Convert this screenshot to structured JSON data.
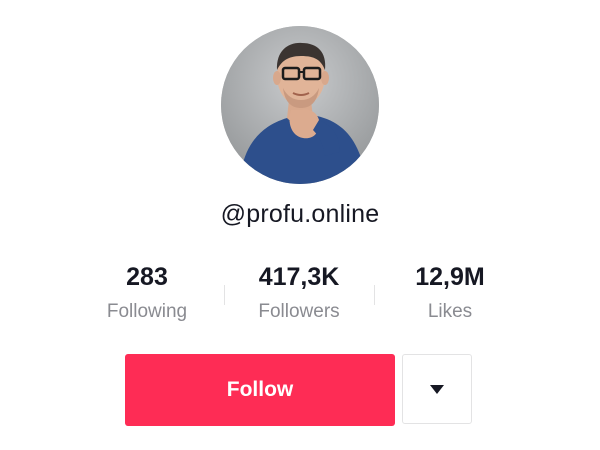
{
  "profile": {
    "username": "@profu.online",
    "avatar_icon": "profile-photo"
  },
  "stats": [
    {
      "value": "283",
      "label": "Following"
    },
    {
      "value": "417,3K",
      "label": "Followers"
    },
    {
      "value": "12,9M",
      "label": "Likes"
    }
  ],
  "actions": {
    "follow_label": "Follow",
    "more_icon": "caret-down-icon"
  },
  "colors": {
    "follow_button": "#fe2c55",
    "primary_text": "#161823",
    "secondary_text": "#8a8b91"
  }
}
